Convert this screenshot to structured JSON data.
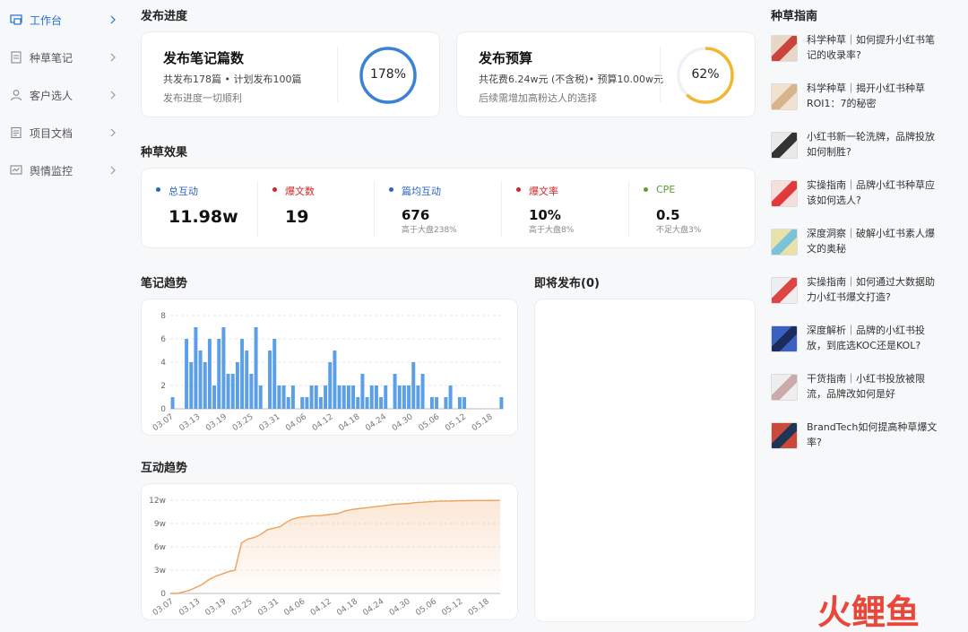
{
  "sidebar": {
    "items": [
      {
        "label": "工作台",
        "icon": "dashboard-icon"
      },
      {
        "label": "种草笔记",
        "icon": "note-icon"
      },
      {
        "label": "客户选人",
        "icon": "user-icon"
      },
      {
        "label": "项目文档",
        "icon": "document-icon"
      },
      {
        "label": "舆情监控",
        "icon": "monitor-icon"
      }
    ],
    "active_index": 0
  },
  "publish_progress": {
    "title": "发布进度",
    "notes_card": {
      "title": "发布笔记篇数",
      "subtitle": "共发布178篇 • 计划发布100篇",
      "note": "发布进度一切顺利",
      "ring_label": "178%",
      "ring_value": 1.0,
      "ring_color": "#3b82d6"
    },
    "budget_card": {
      "title": "发布预算",
      "subtitle": "共花费6.24w元 (不含税)• 预算10.00w元",
      "note": "后续需增加高粉达人的选择",
      "ring_label": "62%",
      "ring_value": 0.62,
      "ring_color": "#f2b632"
    }
  },
  "effect": {
    "title": "种草效果",
    "metrics": [
      {
        "label": "总互动",
        "value": "11.98w",
        "note": "",
        "color": "#2a62c9"
      },
      {
        "label": "爆文数",
        "value": "19",
        "note": "",
        "color": "#d0282c"
      },
      {
        "label": "篇均互动",
        "value": "676",
        "note": "高于大盘238%",
        "color": "#2a62c9"
      },
      {
        "label": "爆文率",
        "value": "10%",
        "note": "高于大盘8%",
        "color": "#d0282c"
      },
      {
        "label": "CPE",
        "value": "0.5",
        "note": "不足大盘3%",
        "color": "#5aa02c"
      }
    ]
  },
  "notes_trend": {
    "title": "笔记趋势"
  },
  "interaction_trend": {
    "title": "互动趋势"
  },
  "upcoming": {
    "title": "即将发布(0)"
  },
  "guide": {
    "title": "种草指南",
    "items": [
      "科学种草｜如何提升小红书笔记的收录率?",
      "科学种草｜揭开小红书种草ROI1：7的秘密",
      "小红书新一轮洗牌，品牌投放如何制胜?",
      "实操指南｜品牌小红书种草应该如何选人?",
      "深度洞察｜破解小红书素人爆文的奥秘",
      "实操指南｜如何通过大数据助力小红书爆文打造?",
      "深度解析｜品牌的小红书投放，到底选KOC还是KOL?",
      "干货指南｜小红书投放被限流，品牌改如何是好",
      "BrandTech如何提高种草爆文率?"
    ]
  },
  "watermark": "火鲤鱼",
  "chart_data": [
    {
      "type": "bar",
      "title": "笔记趋势",
      "color": "#5b9fe9",
      "ylim": [
        0,
        8
      ],
      "yticks": [
        "0",
        "2",
        "4",
        "6",
        "8"
      ],
      "xticks": [
        "03.07",
        "03.13",
        "03.19",
        "03.25",
        "03.31",
        "04.06",
        "04.12",
        "04.18",
        "04.24",
        "04.30",
        "05.06",
        "05.12",
        "05.18"
      ],
      "values": [
        1,
        0,
        0,
        6,
        4,
        7,
        5,
        4,
        6,
        2,
        6,
        7,
        3,
        3,
        4,
        6,
        5,
        3,
        7,
        2,
        0,
        5,
        6,
        2,
        2,
        1,
        2,
        0,
        1,
        1,
        2,
        2,
        1,
        2,
        4,
        5,
        2,
        2,
        2,
        2,
        1,
        3,
        1,
        2,
        2,
        1,
        2,
        0,
        3,
        2,
        2,
        2,
        4,
        2,
        3,
        0,
        1,
        1,
        0,
        1,
        2,
        0,
        1,
        1,
        0,
        0,
        0,
        0,
        0,
        0,
        0,
        1
      ],
      "grid": true
    },
    {
      "type": "area",
      "title": "互动趋势",
      "color": "#f0a05a",
      "ylim": [
        0,
        12
      ],
      "yticks": [
        "0",
        "3w",
        "6w",
        "9w",
        "12w"
      ],
      "xticks": [
        "03.07",
        "03.13",
        "03.19",
        "03.25",
        "03.31",
        "04.06",
        "04.12",
        "04.18",
        "04.24",
        "04.30",
        "05.06",
        "05.12",
        "05.18"
      ],
      "values": [
        0,
        0,
        0.2,
        0.4,
        0.8,
        1.2,
        1.8,
        2.2,
        2.5,
        2.8,
        3.0,
        6.5,
        7.0,
        7.2,
        7.6,
        8.2,
        8.4,
        8.6,
        9.2,
        9.6,
        9.8,
        9.9,
        10.0,
        10.0,
        10.1,
        10.2,
        10.3,
        10.6,
        10.8,
        10.9,
        11.0,
        11.1,
        11.2,
        11.3,
        11.4,
        11.5,
        11.55,
        11.6,
        11.7,
        11.75,
        11.8,
        11.85,
        11.9,
        11.9,
        11.92,
        11.94,
        11.95,
        11.96,
        11.97,
        11.97,
        11.98,
        11.98
      ],
      "grid": true
    }
  ]
}
